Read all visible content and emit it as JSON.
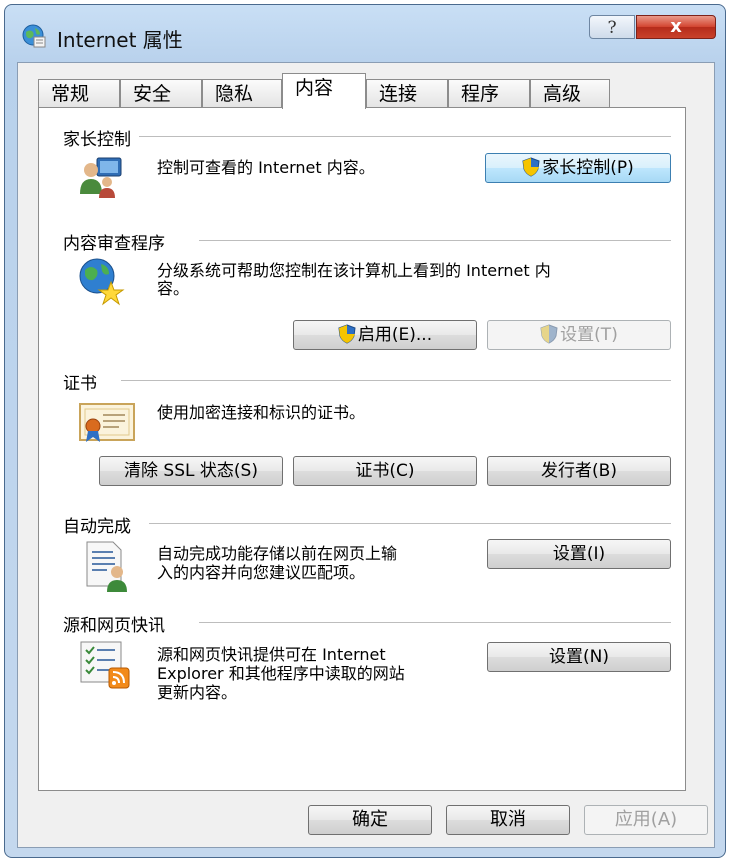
{
  "window": {
    "title": "Internet 属性",
    "help_glyph": "?",
    "close_glyph": "x"
  },
  "tabs": [
    "常规",
    "安全",
    "隐私",
    "内容",
    "连接",
    "程序",
    "高级"
  ],
  "active_tab": "内容",
  "parental": {
    "title": "家长控制",
    "desc": "控制可查看的 Internet 内容。",
    "button": "家长控制(P)"
  },
  "advisor": {
    "title": "内容审查程序",
    "desc_line1": "分级系统可帮助您控制在该计算机上看到的 Internet 内",
    "desc_line2": "容。",
    "enable_button": "启用(E)...",
    "settings_button": "设置(T)"
  },
  "certificates": {
    "title": "证书",
    "desc": "使用加密连接和标识的证书。",
    "clear_ssl_button": "清除 SSL 状态(S)",
    "certs_button": "证书(C)",
    "publishers_button": "发行者(B)"
  },
  "autocomplete": {
    "title": "自动完成",
    "desc_line1": "自动完成功能存储以前在网页上输",
    "desc_line2": "入的内容并向您建议匹配项。",
    "settings_button": "设置(I)"
  },
  "feeds": {
    "title": "源和网页快讯",
    "desc_line1": "源和网页快讯提供可在 Internet",
    "desc_line2": "Explorer 和其他程序中读取的网站",
    "desc_line3": "更新内容。",
    "settings_button": "设置(N)"
  },
  "footer": {
    "ok": "确定",
    "cancel": "取消",
    "apply": "应用(A)"
  }
}
